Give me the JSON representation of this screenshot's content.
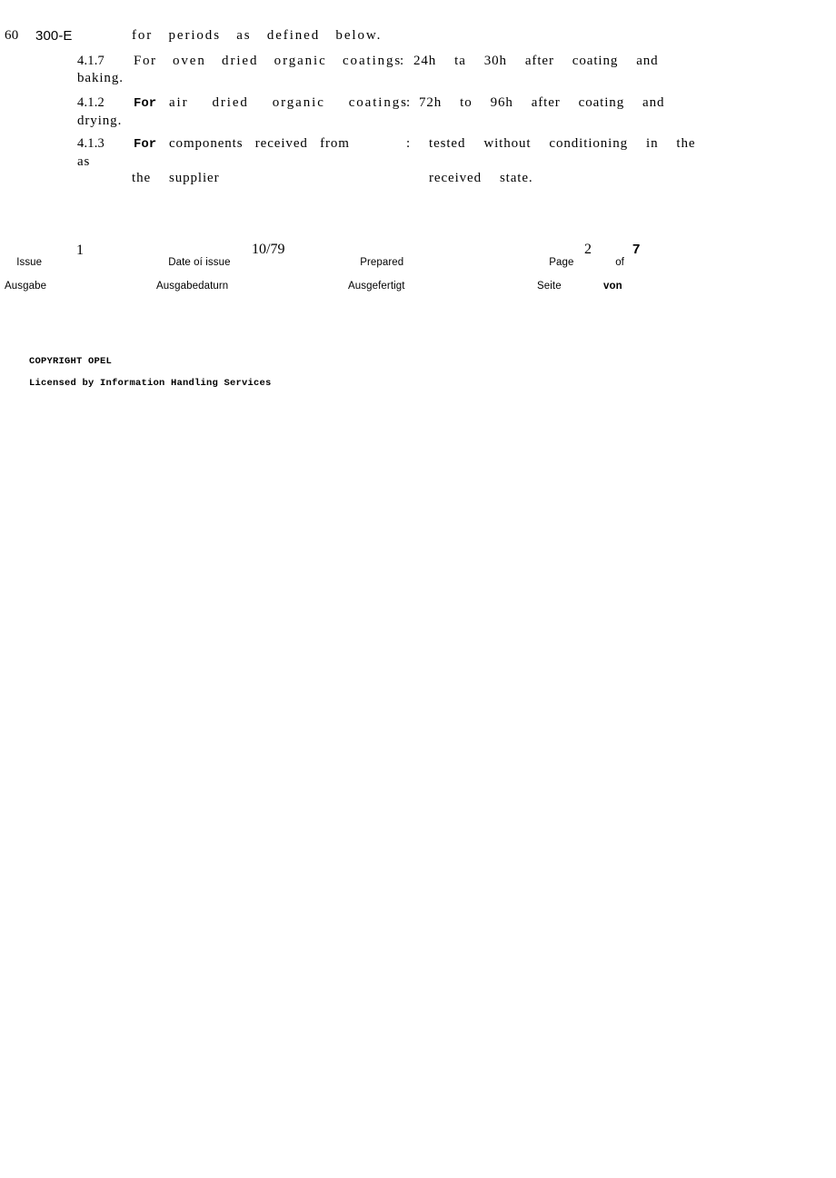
{
  "document": {
    "standard_number_prefix": "60",
    "standard_number_suffix": "300-E",
    "header_continuation": "for  periods  as  defined  below."
  },
  "clauses": [
    {
      "number": "4.1.7",
      "keyword": "For",
      "keyword_bold": false,
      "subject": "oven  dried  organic  coatings",
      "colon": ":",
      "requirement": "24h   ta   30h   after   coating   and",
      "continuation": "baking."
    },
    {
      "number": "4.1.2",
      "keyword": "For",
      "keyword_bold": true,
      "subject": "air   dried   organic   coatings",
      "colon": ":",
      "requirement": "72h   to   96h   after   coating   and",
      "continuation": "drying."
    },
    {
      "number": "4.1.3",
      "keyword": "For",
      "keyword_bold": true,
      "subject": "components  received  from",
      "colon": ":",
      "requirement": "tested   without   conditioning   in   the",
      "continuation_left": "as",
      "continuation_subject": "the   supplier",
      "continuation_requirement": "received   state."
    }
  ],
  "footer": {
    "issue": {
      "label_en": "Issue",
      "label_de": "Ausgabe",
      "value": "1"
    },
    "date_of_issue": {
      "label_en": "Date oí issue",
      "label_de": "Ausgabedaturn",
      "value": "10/79"
    },
    "prepared": {
      "label_en": "Prepared",
      "label_de": "Ausgefertigt",
      "value": ""
    },
    "page": {
      "label_en": "Page",
      "label_de": "Seite",
      "current": "2",
      "of_en": "of",
      "of_de": "von",
      "total": "7"
    }
  },
  "copyright": {
    "line1": "COPYRIGHT OPEL",
    "line2": "Licensed by Information Handling Services"
  }
}
